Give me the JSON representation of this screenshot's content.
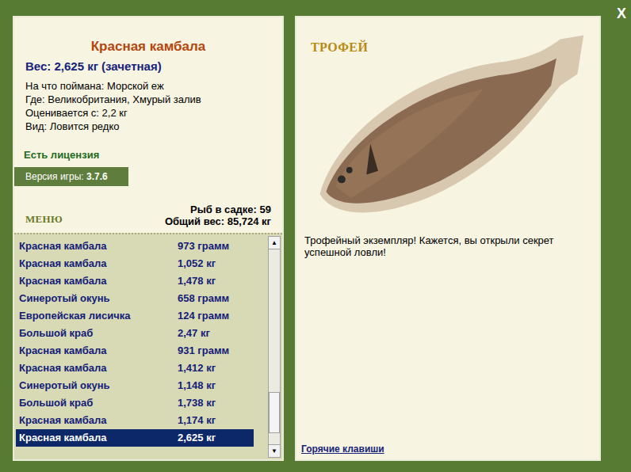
{
  "window": {
    "close": "X"
  },
  "catch": {
    "title": "Красная камбала",
    "weight": "Вес: 2,625 кг (зачетная)",
    "info": [
      "На что поймана: Морской еж",
      "Где: Великобритания, Хмурый залив",
      "Оценивается с: 2,2 кг",
      "Вид: Ловится редко"
    ],
    "license": "Есть лицензия"
  },
  "version": {
    "label": "Версия игры:",
    "value": "3.7.6"
  },
  "menu": "МЕНЮ",
  "stats": {
    "count": "Рыб в садке: 59",
    "total": "Общий вес: 85,724 кг"
  },
  "list": [
    {
      "name": "Красная камбала",
      "weight": "973 грамм",
      "selected": false
    },
    {
      "name": "Красная камбала",
      "weight": "1,052 кг",
      "selected": false
    },
    {
      "name": "Красная камбала",
      "weight": "1,478 кг",
      "selected": false
    },
    {
      "name": "Синеротый окунь",
      "weight": "658 грамм",
      "selected": false
    },
    {
      "name": "Европейская лисичка",
      "weight": "124 грамм",
      "selected": false
    },
    {
      "name": "Большой краб",
      "weight": "2,47 кг",
      "selected": false
    },
    {
      "name": "Красная камбала",
      "weight": "931 грамм",
      "selected": false
    },
    {
      "name": "Красная камбала",
      "weight": "1,412 кг",
      "selected": false
    },
    {
      "name": "Синеротый окунь",
      "weight": "1,148 кг",
      "selected": false
    },
    {
      "name": "Большой краб",
      "weight": "1,738 кг",
      "selected": false
    },
    {
      "name": "Красная камбала",
      "weight": "1,174 кг",
      "selected": false
    },
    {
      "name": "Красная камбала",
      "weight": "2,625 кг",
      "selected": true
    }
  ],
  "scrollbar": {
    "up": "▲",
    "down": "▼",
    "level": 0.9
  },
  "trophy": {
    "badge": "ТРОФЕЙ",
    "message": "Трофейный экземпляр! Кажется, вы открыли секрет успешной ловли!"
  },
  "hotkeys": "Горячие клавиши"
}
